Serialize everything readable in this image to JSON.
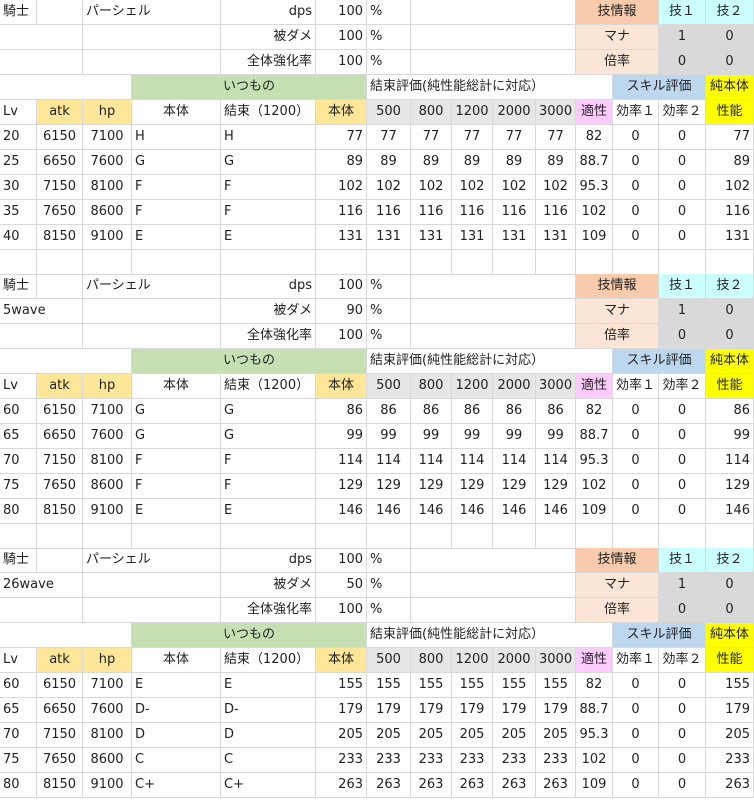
{
  "colors": {
    "orange": "#f8cbad",
    "peach": "#fbe5d6",
    "cyan": "#ccffff",
    "gray": "#d9d9d9",
    "light_gray": "#e6e6e6",
    "green": "#c6e0b4",
    "blue": "#bdd7ee",
    "yellow": "#ffff00",
    "gold": "#ffe699",
    "pink": "#ffccff"
  },
  "labels": {
    "class": "騎士",
    "name": "パーシェル",
    "dps": "dps",
    "damage_taken": "被ダメ",
    "global_boost": "全体強化率",
    "percent": "%",
    "skill_info": "技情報",
    "skill1": "技１",
    "skill2": "技２",
    "mana": "マナ",
    "multiplier": "倍率",
    "usual": "いつもの",
    "bond_eval": "結束評価(純性能総計に対応）",
    "skill_eval": "スキル評価",
    "pure_body_top": "純本体",
    "pure_body_bottom": "性能",
    "col_lv": "Lv",
    "col_atk": "atk",
    "col_hp": "hp",
    "col_body": "本体",
    "col_bond": "結束（1200）",
    "col_body2": "本体",
    "bond_cols": [
      "500",
      "800",
      "1200",
      "2000",
      "3000"
    ],
    "col_aptitude": "適性",
    "col_eff1": "効率１",
    "col_eff2": "効率２"
  },
  "blocks": [
    {
      "subtitle": "",
      "dps": "100",
      "damage_taken": "100",
      "global_boost": "100",
      "mana": [
        "1",
        "0"
      ],
      "multiplier": [
        "0",
        "0"
      ],
      "rows": [
        {
          "lv": "20",
          "atk": "6150",
          "hp": "7100",
          "body": "H",
          "bond": "H",
          "body_score": "77",
          "bonds": [
            "77",
            "77",
            "77",
            "77",
            "77"
          ],
          "aptitude": "82",
          "eff1": "0",
          "eff2": "0",
          "pure": "77"
        },
        {
          "lv": "25",
          "atk": "6650",
          "hp": "7600",
          "body": "G",
          "bond": "G",
          "body_score": "89",
          "bonds": [
            "89",
            "89",
            "89",
            "89",
            "89"
          ],
          "aptitude": "88.7",
          "eff1": "0",
          "eff2": "0",
          "pure": "89"
        },
        {
          "lv": "30",
          "atk": "7150",
          "hp": "8100",
          "body": "F",
          "bond": "F",
          "body_score": "102",
          "bonds": [
            "102",
            "102",
            "102",
            "102",
            "102"
          ],
          "aptitude": "95.3",
          "eff1": "0",
          "eff2": "0",
          "pure": "102"
        },
        {
          "lv": "35",
          "atk": "7650",
          "hp": "8600",
          "body": "F",
          "bond": "F",
          "body_score": "116",
          "bonds": [
            "116",
            "116",
            "116",
            "116",
            "116"
          ],
          "aptitude": "102",
          "eff1": "0",
          "eff2": "0",
          "pure": "116"
        },
        {
          "lv": "40",
          "atk": "8150",
          "hp": "9100",
          "body": "E",
          "bond": "E",
          "body_score": "131",
          "bonds": [
            "131",
            "131",
            "131",
            "131",
            "131"
          ],
          "aptitude": "109",
          "eff1": "0",
          "eff2": "0",
          "pure": "131"
        }
      ]
    },
    {
      "subtitle": "5wave",
      "dps": "100",
      "damage_taken": "90",
      "global_boost": "100",
      "mana": [
        "1",
        "0"
      ],
      "multiplier": [
        "0",
        "0"
      ],
      "rows": [
        {
          "lv": "60",
          "atk": "6150",
          "hp": "7100",
          "body": "G",
          "bond": "G",
          "body_score": "86",
          "bonds": [
            "86",
            "86",
            "86",
            "86",
            "86"
          ],
          "aptitude": "82",
          "eff1": "0",
          "eff2": "0",
          "pure": "86"
        },
        {
          "lv": "65",
          "atk": "6650",
          "hp": "7600",
          "body": "G",
          "bond": "G",
          "body_score": "99",
          "bonds": [
            "99",
            "99",
            "99",
            "99",
            "99"
          ],
          "aptitude": "88.7",
          "eff1": "0",
          "eff2": "0",
          "pure": "99"
        },
        {
          "lv": "70",
          "atk": "7150",
          "hp": "8100",
          "body": "F",
          "bond": "F",
          "body_score": "114",
          "bonds": [
            "114",
            "114",
            "114",
            "114",
            "114"
          ],
          "aptitude": "95.3",
          "eff1": "0",
          "eff2": "0",
          "pure": "114"
        },
        {
          "lv": "75",
          "atk": "7650",
          "hp": "8600",
          "body": "F",
          "bond": "F",
          "body_score": "129",
          "bonds": [
            "129",
            "129",
            "129",
            "129",
            "129"
          ],
          "aptitude": "102",
          "eff1": "0",
          "eff2": "0",
          "pure": "129"
        },
        {
          "lv": "80",
          "atk": "8150",
          "hp": "9100",
          "body": "E",
          "bond": "E",
          "body_score": "146",
          "bonds": [
            "146",
            "146",
            "146",
            "146",
            "146"
          ],
          "aptitude": "109",
          "eff1": "0",
          "eff2": "0",
          "pure": "146"
        }
      ]
    },
    {
      "subtitle": "26wave",
      "dps": "100",
      "damage_taken": "50",
      "global_boost": "100",
      "mana": [
        "1",
        "0"
      ],
      "multiplier": [
        "0",
        "0"
      ],
      "rows": [
        {
          "lv": "60",
          "atk": "6150",
          "hp": "7100",
          "body": "E",
          "bond": "E",
          "body_score": "155",
          "bonds": [
            "155",
            "155",
            "155",
            "155",
            "155"
          ],
          "aptitude": "82",
          "eff1": "0",
          "eff2": "0",
          "pure": "155"
        },
        {
          "lv": "65",
          "atk": "6650",
          "hp": "7600",
          "body": "D-",
          "bond": "D-",
          "body_score": "179",
          "bonds": [
            "179",
            "179",
            "179",
            "179",
            "179"
          ],
          "aptitude": "88.7",
          "eff1": "0",
          "eff2": "0",
          "pure": "179"
        },
        {
          "lv": "70",
          "atk": "7150",
          "hp": "8100",
          "body": "D",
          "bond": "D",
          "body_score": "205",
          "bonds": [
            "205",
            "205",
            "205",
            "205",
            "205"
          ],
          "aptitude": "95.3",
          "eff1": "0",
          "eff2": "0",
          "pure": "205"
        },
        {
          "lv": "75",
          "atk": "7650",
          "hp": "8600",
          "body": "C",
          "bond": "C",
          "body_score": "233",
          "bonds": [
            "233",
            "233",
            "233",
            "233",
            "233"
          ],
          "aptitude": "102",
          "eff1": "0",
          "eff2": "0",
          "pure": "233"
        },
        {
          "lv": "80",
          "atk": "8150",
          "hp": "9100",
          "body": "C+",
          "bond": "C+",
          "body_score": "263",
          "bonds": [
            "263",
            "263",
            "263",
            "263",
            "263"
          ],
          "aptitude": "109",
          "eff1": "0",
          "eff2": "0",
          "pure": "263"
        }
      ]
    }
  ]
}
